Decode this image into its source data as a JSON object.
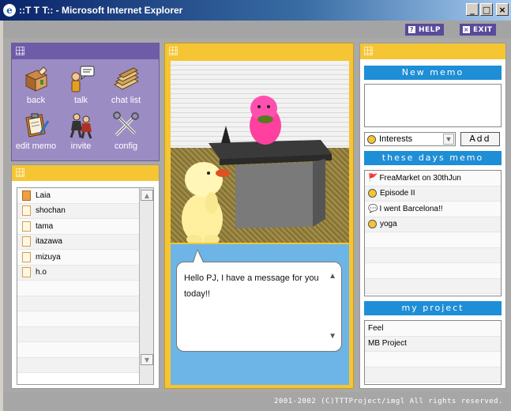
{
  "window": {
    "title": "::T T T:: - Microsoft Internet Explorer",
    "minimize": "_",
    "maximize": "□",
    "close": "×"
  },
  "toolbar": {
    "help_label": "HELP",
    "help_mark": "?",
    "exit_label": "EXIT",
    "exit_mark": "×"
  },
  "menu": {
    "items": [
      {
        "label": "back",
        "icon": "box-icon"
      },
      {
        "label": "talk",
        "icon": "talk-icon"
      },
      {
        "label": "chat list",
        "icon": "folder-stack-icon"
      },
      {
        "label": "edit memo",
        "icon": "clipboard-icon"
      },
      {
        "label": "invite",
        "icon": "people-icon"
      },
      {
        "label": "config",
        "icon": "tools-icon"
      }
    ]
  },
  "buddies": {
    "items": [
      "Laia",
      "shochan",
      "tama",
      "itazawa",
      "mizuya",
      "h.o"
    ],
    "active_index": 0
  },
  "chat": {
    "message": "Hello PJ, I have a message for you today!!"
  },
  "right": {
    "new_memo_title": "New memo",
    "memo_text": "",
    "interest_selected": "Interests",
    "add_label": "Add",
    "these_days_title": "these days memo",
    "these_days": [
      {
        "text": "FreaMarket on 30thJun",
        "icon": "flag-icon"
      },
      {
        "text": "Episode II",
        "icon": "smile-icon"
      },
      {
        "text": "I went Barcelona!!",
        "icon": "speech-icon"
      },
      {
        "text": "yoga",
        "icon": "smile-icon"
      }
    ],
    "project_title": "my project",
    "projects": [
      "Feel",
      "MB Project"
    ]
  },
  "footer": {
    "text": "2001-2002 (C)TTTProject/imgl All rights reserved."
  },
  "colors": {
    "purple": "#9c8cc4",
    "yellow": "#f5c534",
    "blue": "#1e8ed6",
    "sky": "#6db5e6"
  }
}
